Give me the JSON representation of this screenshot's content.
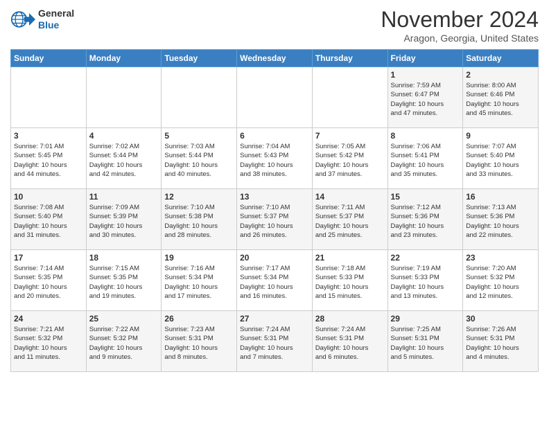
{
  "header": {
    "logo_general": "General",
    "logo_blue": "Blue",
    "month_title": "November 2024",
    "location": "Aragon, Georgia, United States"
  },
  "weekdays": [
    "Sunday",
    "Monday",
    "Tuesday",
    "Wednesday",
    "Thursday",
    "Friday",
    "Saturday"
  ],
  "weeks": [
    [
      {
        "day": "",
        "info": ""
      },
      {
        "day": "",
        "info": ""
      },
      {
        "day": "",
        "info": ""
      },
      {
        "day": "",
        "info": ""
      },
      {
        "day": "",
        "info": ""
      },
      {
        "day": "1",
        "info": "Sunrise: 7:59 AM\nSunset: 6:47 PM\nDaylight: 10 hours\nand 47 minutes."
      },
      {
        "day": "2",
        "info": "Sunrise: 8:00 AM\nSunset: 6:46 PM\nDaylight: 10 hours\nand 45 minutes."
      }
    ],
    [
      {
        "day": "3",
        "info": "Sunrise: 7:01 AM\nSunset: 5:45 PM\nDaylight: 10 hours\nand 44 minutes."
      },
      {
        "day": "4",
        "info": "Sunrise: 7:02 AM\nSunset: 5:44 PM\nDaylight: 10 hours\nand 42 minutes."
      },
      {
        "day": "5",
        "info": "Sunrise: 7:03 AM\nSunset: 5:44 PM\nDaylight: 10 hours\nand 40 minutes."
      },
      {
        "day": "6",
        "info": "Sunrise: 7:04 AM\nSunset: 5:43 PM\nDaylight: 10 hours\nand 38 minutes."
      },
      {
        "day": "7",
        "info": "Sunrise: 7:05 AM\nSunset: 5:42 PM\nDaylight: 10 hours\nand 37 minutes."
      },
      {
        "day": "8",
        "info": "Sunrise: 7:06 AM\nSunset: 5:41 PM\nDaylight: 10 hours\nand 35 minutes."
      },
      {
        "day": "9",
        "info": "Sunrise: 7:07 AM\nSunset: 5:40 PM\nDaylight: 10 hours\nand 33 minutes."
      }
    ],
    [
      {
        "day": "10",
        "info": "Sunrise: 7:08 AM\nSunset: 5:40 PM\nDaylight: 10 hours\nand 31 minutes."
      },
      {
        "day": "11",
        "info": "Sunrise: 7:09 AM\nSunset: 5:39 PM\nDaylight: 10 hours\nand 30 minutes."
      },
      {
        "day": "12",
        "info": "Sunrise: 7:10 AM\nSunset: 5:38 PM\nDaylight: 10 hours\nand 28 minutes."
      },
      {
        "day": "13",
        "info": "Sunrise: 7:10 AM\nSunset: 5:37 PM\nDaylight: 10 hours\nand 26 minutes."
      },
      {
        "day": "14",
        "info": "Sunrise: 7:11 AM\nSunset: 5:37 PM\nDaylight: 10 hours\nand 25 minutes."
      },
      {
        "day": "15",
        "info": "Sunrise: 7:12 AM\nSunset: 5:36 PM\nDaylight: 10 hours\nand 23 minutes."
      },
      {
        "day": "16",
        "info": "Sunrise: 7:13 AM\nSunset: 5:36 PM\nDaylight: 10 hours\nand 22 minutes."
      }
    ],
    [
      {
        "day": "17",
        "info": "Sunrise: 7:14 AM\nSunset: 5:35 PM\nDaylight: 10 hours\nand 20 minutes."
      },
      {
        "day": "18",
        "info": "Sunrise: 7:15 AM\nSunset: 5:35 PM\nDaylight: 10 hours\nand 19 minutes."
      },
      {
        "day": "19",
        "info": "Sunrise: 7:16 AM\nSunset: 5:34 PM\nDaylight: 10 hours\nand 17 minutes."
      },
      {
        "day": "20",
        "info": "Sunrise: 7:17 AM\nSunset: 5:34 PM\nDaylight: 10 hours\nand 16 minutes."
      },
      {
        "day": "21",
        "info": "Sunrise: 7:18 AM\nSunset: 5:33 PM\nDaylight: 10 hours\nand 15 minutes."
      },
      {
        "day": "22",
        "info": "Sunrise: 7:19 AM\nSunset: 5:33 PM\nDaylight: 10 hours\nand 13 minutes."
      },
      {
        "day": "23",
        "info": "Sunrise: 7:20 AM\nSunset: 5:32 PM\nDaylight: 10 hours\nand 12 minutes."
      }
    ],
    [
      {
        "day": "24",
        "info": "Sunrise: 7:21 AM\nSunset: 5:32 PM\nDaylight: 10 hours\nand 11 minutes."
      },
      {
        "day": "25",
        "info": "Sunrise: 7:22 AM\nSunset: 5:32 PM\nDaylight: 10 hours\nand 9 minutes."
      },
      {
        "day": "26",
        "info": "Sunrise: 7:23 AM\nSunset: 5:31 PM\nDaylight: 10 hours\nand 8 minutes."
      },
      {
        "day": "27",
        "info": "Sunrise: 7:24 AM\nSunset: 5:31 PM\nDaylight: 10 hours\nand 7 minutes."
      },
      {
        "day": "28",
        "info": "Sunrise: 7:24 AM\nSunset: 5:31 PM\nDaylight: 10 hours\nand 6 minutes."
      },
      {
        "day": "29",
        "info": "Sunrise: 7:25 AM\nSunset: 5:31 PM\nDaylight: 10 hours\nand 5 minutes."
      },
      {
        "day": "30",
        "info": "Sunrise: 7:26 AM\nSunset: 5:31 PM\nDaylight: 10 hours\nand 4 minutes."
      }
    ]
  ]
}
